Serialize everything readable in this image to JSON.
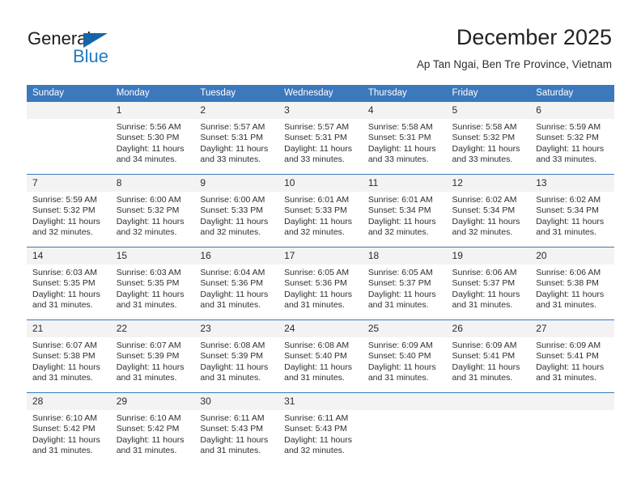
{
  "brand": {
    "name_part1": "General",
    "name_part2": "Blue",
    "triangle_icon": "triangle-icon",
    "accent_dark": "#1565a8",
    "accent_light": "#1f7ac1"
  },
  "header": {
    "title": "December 2025",
    "subtitle": "Ap Tan Ngai, Ben Tre Province, Vietnam"
  },
  "theme": {
    "header_blue": "#3b78bc",
    "daynum_gray": "#f3f3f3",
    "text": "#2e2e2e"
  },
  "columns": [
    "Sunday",
    "Monday",
    "Tuesday",
    "Wednesday",
    "Thursday",
    "Friday",
    "Saturday"
  ],
  "weeks": [
    [
      {
        "day": "",
        "blank": true,
        "sunrise": "",
        "sunset": "",
        "daylight_line1": "",
        "daylight_line2": ""
      },
      {
        "day": "1",
        "blank": false,
        "sunrise": "Sunrise: 5:56 AM",
        "sunset": "Sunset: 5:30 PM",
        "daylight_line1": "Daylight: 11 hours",
        "daylight_line2": "and 34 minutes."
      },
      {
        "day": "2",
        "blank": false,
        "sunrise": "Sunrise: 5:57 AM",
        "sunset": "Sunset: 5:31 PM",
        "daylight_line1": "Daylight: 11 hours",
        "daylight_line2": "and 33 minutes."
      },
      {
        "day": "3",
        "blank": false,
        "sunrise": "Sunrise: 5:57 AM",
        "sunset": "Sunset: 5:31 PM",
        "daylight_line1": "Daylight: 11 hours",
        "daylight_line2": "and 33 minutes."
      },
      {
        "day": "4",
        "blank": false,
        "sunrise": "Sunrise: 5:58 AM",
        "sunset": "Sunset: 5:31 PM",
        "daylight_line1": "Daylight: 11 hours",
        "daylight_line2": "and 33 minutes."
      },
      {
        "day": "5",
        "blank": false,
        "sunrise": "Sunrise: 5:58 AM",
        "sunset": "Sunset: 5:32 PM",
        "daylight_line1": "Daylight: 11 hours",
        "daylight_line2": "and 33 minutes."
      },
      {
        "day": "6",
        "blank": false,
        "sunrise": "Sunrise: 5:59 AM",
        "sunset": "Sunset: 5:32 PM",
        "daylight_line1": "Daylight: 11 hours",
        "daylight_line2": "and 33 minutes."
      }
    ],
    [
      {
        "day": "7",
        "blank": false,
        "sunrise": "Sunrise: 5:59 AM",
        "sunset": "Sunset: 5:32 PM",
        "daylight_line1": "Daylight: 11 hours",
        "daylight_line2": "and 32 minutes."
      },
      {
        "day": "8",
        "blank": false,
        "sunrise": "Sunrise: 6:00 AM",
        "sunset": "Sunset: 5:32 PM",
        "daylight_line1": "Daylight: 11 hours",
        "daylight_line2": "and 32 minutes."
      },
      {
        "day": "9",
        "blank": false,
        "sunrise": "Sunrise: 6:00 AM",
        "sunset": "Sunset: 5:33 PM",
        "daylight_line1": "Daylight: 11 hours",
        "daylight_line2": "and 32 minutes."
      },
      {
        "day": "10",
        "blank": false,
        "sunrise": "Sunrise: 6:01 AM",
        "sunset": "Sunset: 5:33 PM",
        "daylight_line1": "Daylight: 11 hours",
        "daylight_line2": "and 32 minutes."
      },
      {
        "day": "11",
        "blank": false,
        "sunrise": "Sunrise: 6:01 AM",
        "sunset": "Sunset: 5:34 PM",
        "daylight_line1": "Daylight: 11 hours",
        "daylight_line2": "and 32 minutes."
      },
      {
        "day": "12",
        "blank": false,
        "sunrise": "Sunrise: 6:02 AM",
        "sunset": "Sunset: 5:34 PM",
        "daylight_line1": "Daylight: 11 hours",
        "daylight_line2": "and 32 minutes."
      },
      {
        "day": "13",
        "blank": false,
        "sunrise": "Sunrise: 6:02 AM",
        "sunset": "Sunset: 5:34 PM",
        "daylight_line1": "Daylight: 11 hours",
        "daylight_line2": "and 31 minutes."
      }
    ],
    [
      {
        "day": "14",
        "blank": false,
        "sunrise": "Sunrise: 6:03 AM",
        "sunset": "Sunset: 5:35 PM",
        "daylight_line1": "Daylight: 11 hours",
        "daylight_line2": "and 31 minutes."
      },
      {
        "day": "15",
        "blank": false,
        "sunrise": "Sunrise: 6:03 AM",
        "sunset": "Sunset: 5:35 PM",
        "daylight_line1": "Daylight: 11 hours",
        "daylight_line2": "and 31 minutes."
      },
      {
        "day": "16",
        "blank": false,
        "sunrise": "Sunrise: 6:04 AM",
        "sunset": "Sunset: 5:36 PM",
        "daylight_line1": "Daylight: 11 hours",
        "daylight_line2": "and 31 minutes."
      },
      {
        "day": "17",
        "blank": false,
        "sunrise": "Sunrise: 6:05 AM",
        "sunset": "Sunset: 5:36 PM",
        "daylight_line1": "Daylight: 11 hours",
        "daylight_line2": "and 31 minutes."
      },
      {
        "day": "18",
        "blank": false,
        "sunrise": "Sunrise: 6:05 AM",
        "sunset": "Sunset: 5:37 PM",
        "daylight_line1": "Daylight: 11 hours",
        "daylight_line2": "and 31 minutes."
      },
      {
        "day": "19",
        "blank": false,
        "sunrise": "Sunrise: 6:06 AM",
        "sunset": "Sunset: 5:37 PM",
        "daylight_line1": "Daylight: 11 hours",
        "daylight_line2": "and 31 minutes."
      },
      {
        "day": "20",
        "blank": false,
        "sunrise": "Sunrise: 6:06 AM",
        "sunset": "Sunset: 5:38 PM",
        "daylight_line1": "Daylight: 11 hours",
        "daylight_line2": "and 31 minutes."
      }
    ],
    [
      {
        "day": "21",
        "blank": false,
        "sunrise": "Sunrise: 6:07 AM",
        "sunset": "Sunset: 5:38 PM",
        "daylight_line1": "Daylight: 11 hours",
        "daylight_line2": "and 31 minutes."
      },
      {
        "day": "22",
        "blank": false,
        "sunrise": "Sunrise: 6:07 AM",
        "sunset": "Sunset: 5:39 PM",
        "daylight_line1": "Daylight: 11 hours",
        "daylight_line2": "and 31 minutes."
      },
      {
        "day": "23",
        "blank": false,
        "sunrise": "Sunrise: 6:08 AM",
        "sunset": "Sunset: 5:39 PM",
        "daylight_line1": "Daylight: 11 hours",
        "daylight_line2": "and 31 minutes."
      },
      {
        "day": "24",
        "blank": false,
        "sunrise": "Sunrise: 6:08 AM",
        "sunset": "Sunset: 5:40 PM",
        "daylight_line1": "Daylight: 11 hours",
        "daylight_line2": "and 31 minutes."
      },
      {
        "day": "25",
        "blank": false,
        "sunrise": "Sunrise: 6:09 AM",
        "sunset": "Sunset: 5:40 PM",
        "daylight_line1": "Daylight: 11 hours",
        "daylight_line2": "and 31 minutes."
      },
      {
        "day": "26",
        "blank": false,
        "sunrise": "Sunrise: 6:09 AM",
        "sunset": "Sunset: 5:41 PM",
        "daylight_line1": "Daylight: 11 hours",
        "daylight_line2": "and 31 minutes."
      },
      {
        "day": "27",
        "blank": false,
        "sunrise": "Sunrise: 6:09 AM",
        "sunset": "Sunset: 5:41 PM",
        "daylight_line1": "Daylight: 11 hours",
        "daylight_line2": "and 31 minutes."
      }
    ],
    [
      {
        "day": "28",
        "blank": false,
        "sunrise": "Sunrise: 6:10 AM",
        "sunset": "Sunset: 5:42 PM",
        "daylight_line1": "Daylight: 11 hours",
        "daylight_line2": "and 31 minutes."
      },
      {
        "day": "29",
        "blank": false,
        "sunrise": "Sunrise: 6:10 AM",
        "sunset": "Sunset: 5:42 PM",
        "daylight_line1": "Daylight: 11 hours",
        "daylight_line2": "and 31 minutes."
      },
      {
        "day": "30",
        "blank": false,
        "sunrise": "Sunrise: 6:11 AM",
        "sunset": "Sunset: 5:43 PM",
        "daylight_line1": "Daylight: 11 hours",
        "daylight_line2": "and 31 minutes."
      },
      {
        "day": "31",
        "blank": false,
        "sunrise": "Sunrise: 6:11 AM",
        "sunset": "Sunset: 5:43 PM",
        "daylight_line1": "Daylight: 11 hours",
        "daylight_line2": "and 32 minutes."
      },
      {
        "day": "",
        "blank": true,
        "sunrise": "",
        "sunset": "",
        "daylight_line1": "",
        "daylight_line2": ""
      },
      {
        "day": "",
        "blank": true,
        "sunrise": "",
        "sunset": "",
        "daylight_line1": "",
        "daylight_line2": ""
      },
      {
        "day": "",
        "blank": true,
        "sunrise": "",
        "sunset": "",
        "daylight_line1": "",
        "daylight_line2": ""
      }
    ]
  ]
}
